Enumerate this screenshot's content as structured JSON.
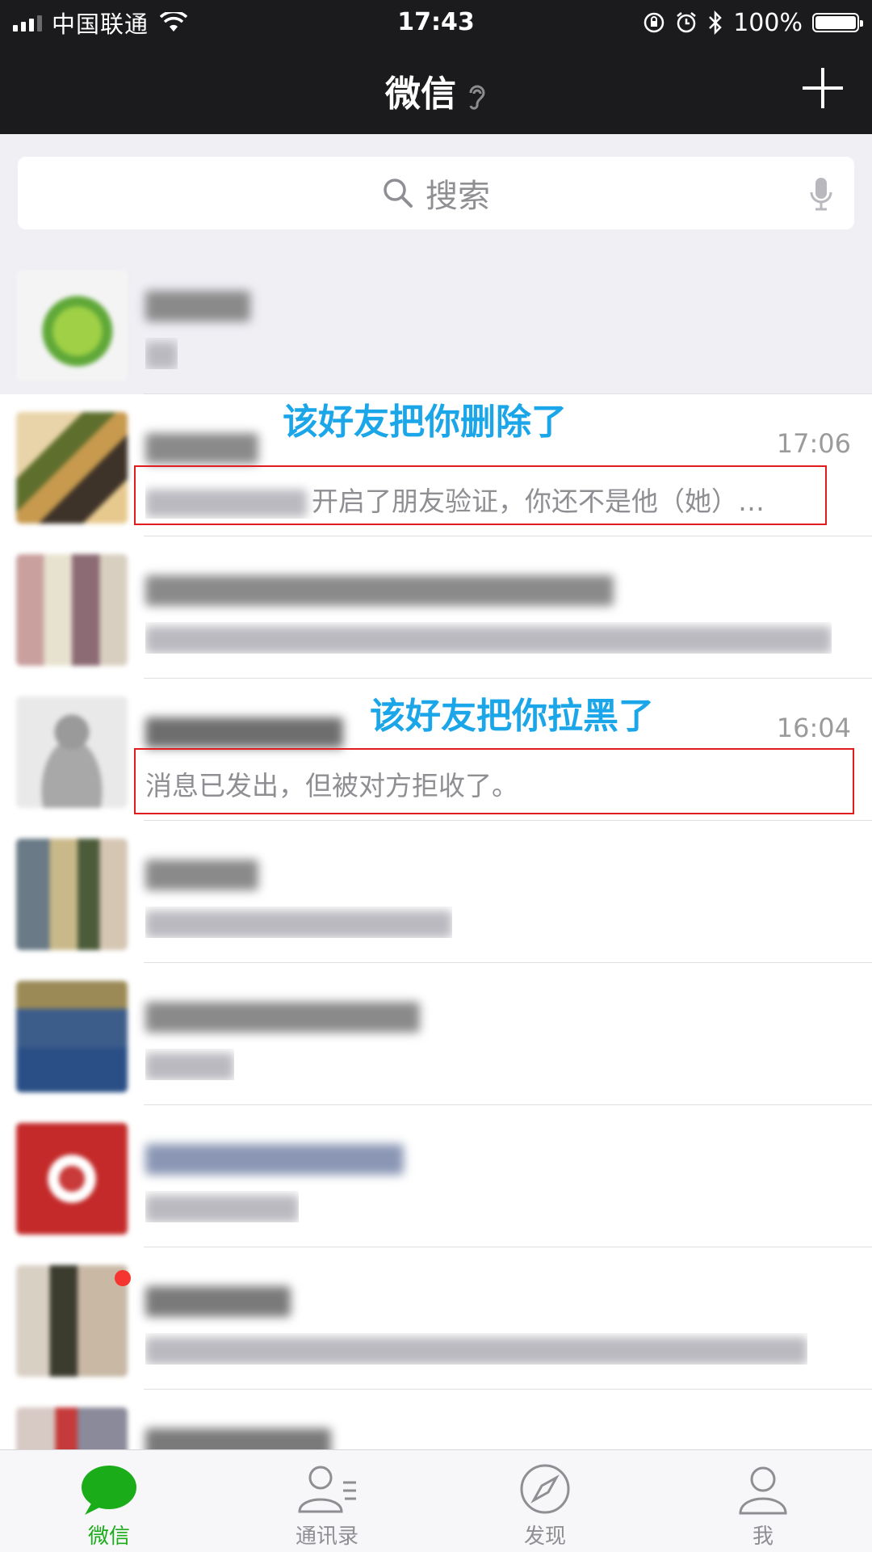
{
  "status_bar": {
    "carrier": "中国联通",
    "time": "17:43",
    "battery": "100%"
  },
  "nav": {
    "title": "微信",
    "ear_icon": "ear-icon",
    "add_icon": "plus-icon"
  },
  "search": {
    "placeholder": "搜索",
    "icon": "search-icon",
    "voice_icon": "microphone-icon"
  },
  "chats": [
    {
      "time": "",
      "preview": "",
      "pinned": true
    },
    {
      "time": "17:06",
      "preview": "开启了朋友验证，你还不是他（她）…",
      "annotation": "该好友把你删除了"
    },
    {
      "time": "",
      "preview": ""
    },
    {
      "time": "16:04",
      "preview": "消息已发出，但被对方拒收了。",
      "annotation": "该好友把你拉黑了"
    },
    {
      "time": "",
      "preview": ""
    },
    {
      "time": "",
      "preview": ""
    },
    {
      "time": "",
      "preview": ""
    },
    {
      "time": "",
      "preview": ""
    },
    {
      "time": "",
      "preview": ""
    }
  ],
  "tabs": [
    {
      "label": "微信",
      "icon": "chat-bubble-icon",
      "active": true
    },
    {
      "label": "通讯录",
      "icon": "contacts-icon"
    },
    {
      "label": "发现",
      "icon": "compass-icon"
    },
    {
      "label": "我",
      "icon": "person-icon"
    }
  ],
  "colors": {
    "nav_bg": "#1b1b1d",
    "accent_green": "#1aad19",
    "annotation_blue": "#1aa6e8",
    "highlight_red": "#e21c1c"
  }
}
